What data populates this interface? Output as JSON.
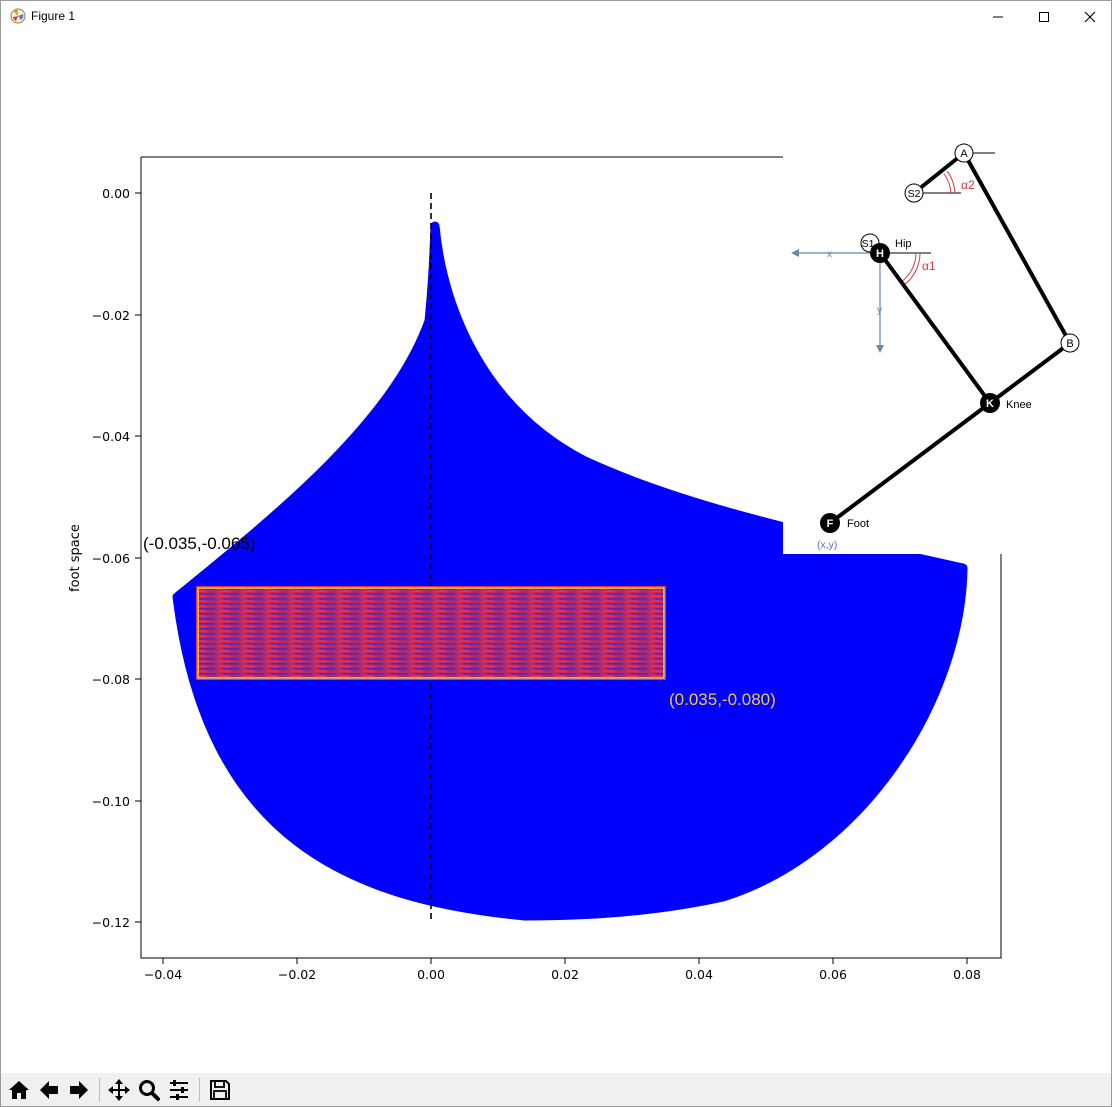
{
  "window": {
    "title": "Figure 1"
  },
  "toolbar": {
    "buttons": [
      "home",
      "back",
      "forward",
      "pan",
      "zoom",
      "configure-subplots",
      "save"
    ]
  },
  "colors": {
    "scatter": "#0000ff",
    "rect_fill": "#c0304e",
    "rect_border": "#ffd24a",
    "annot_yellow": "#f2c84b",
    "link": "#000000",
    "axis_arrow": "#6a86ad",
    "angle": "#d23b3b"
  },
  "chart_data": {
    "type": "scatter",
    "title": "",
    "xlabel": "",
    "ylabel": "foot space",
    "xlim": [
      -0.0425,
      0.085
    ],
    "ylim": [
      -0.126,
      0.006
    ],
    "xticks": [
      "−0.04",
      "−0.02",
      "0.00",
      "0.02",
      "0.04",
      "0.06",
      "0.08"
    ],
    "yticks": [
      "0.00",
      "−0.02",
      "−0.04",
      "−0.06",
      "−0.08",
      "−0.10",
      "−0.12"
    ],
    "workspace_region": {
      "tip": [
        0.001,
        -0.0055
      ],
      "left_corner": [
        -0.0375,
        -0.0665
      ],
      "right_corner": [
        0.0795,
        -0.0615
      ],
      "bottom": [
        0.014,
        -0.119
      ]
    },
    "dashed_line": {
      "x": 0.0,
      "y_from": 0.0,
      "y_to": -0.12
    },
    "rectangle": {
      "x": [
        -0.035,
        0.035
      ],
      "y": [
        -0.08,
        -0.065
      ]
    },
    "annotations": [
      {
        "text": "(-0.035,-0.065)",
        "x": -0.035,
        "y": -0.065
      },
      {
        "text": "(0.035,-0.080)",
        "x": 0.035,
        "y": -0.08
      }
    ]
  },
  "diagram": {
    "labels": {
      "A": "A",
      "B": "B",
      "S2": "S2",
      "S1": "S1",
      "H": "H",
      "K": "K",
      "F": "F",
      "hip": "Hip",
      "knee": "Knee",
      "foot": "Foot",
      "xy": "(x,y)",
      "x": "x",
      "y": "y",
      "alpha1": "α1",
      "alpha2": "α2"
    }
  }
}
